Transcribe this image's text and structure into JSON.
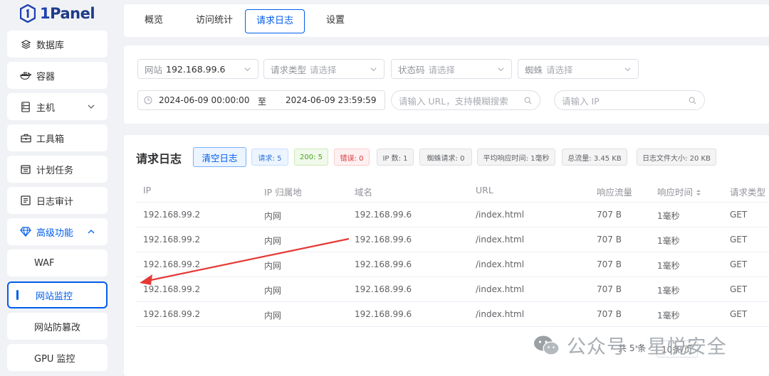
{
  "brand": {
    "logo_prefix": "1",
    "logo_name": "Panel"
  },
  "sidebar": {
    "items": [
      {
        "label": "数据库",
        "icon": "database-icon"
      },
      {
        "label": "容器",
        "icon": "docker-icon"
      },
      {
        "label": "主机",
        "icon": "host-icon"
      },
      {
        "label": "工具箱",
        "icon": "toolbox-icon"
      },
      {
        "label": "计划任务",
        "icon": "calendar-icon"
      },
      {
        "label": "日志审计",
        "icon": "log-audit-icon"
      },
      {
        "label": "高级功能",
        "icon": "diamond-icon"
      }
    ],
    "subitems": [
      {
        "label": "WAF"
      },
      {
        "label": "网站监控"
      },
      {
        "label": "网站防篡改"
      },
      {
        "label": "GPU 监控"
      }
    ]
  },
  "tabs": [
    {
      "label": "概览"
    },
    {
      "label": "访问统计"
    },
    {
      "label": "请求日志"
    },
    {
      "label": "设置"
    }
  ],
  "filters": {
    "site": {
      "label": "网站",
      "value": "192.168.99.6"
    },
    "request_type": {
      "label": "请求类型",
      "placeholder": "请选择"
    },
    "status_code": {
      "label": "状态码",
      "placeholder": "请选择"
    },
    "spider": {
      "label": "蜘蛛",
      "placeholder": "请选择"
    },
    "date_start": "2024-06-09 00:00:00",
    "date_sep": "至",
    "date_end": "2024-06-09 23:59:59",
    "url_placeholder": "请输入 URL，支持模糊搜索",
    "ip_placeholder": "请输入 IP"
  },
  "log": {
    "title": "请求日志",
    "clear_label": "清空日志",
    "stats": [
      "请求: 5",
      "200: 5",
      "错误: 0",
      "IP 数: 1",
      "蜘蛛请求: 0",
      "平均响应时间: 1毫秒",
      "总流量: 3.45 KB",
      "日志文件大小: 20 KB"
    ],
    "columns": [
      "IP",
      "IP 归属地",
      "域名",
      "URL",
      "响应流量",
      "响应时间",
      "请求类型"
    ],
    "rows": [
      [
        "192.168.99.2",
        "内网",
        "192.168.99.6",
        "/index.html",
        "707 B",
        "1毫秒",
        "GET"
      ],
      [
        "192.168.99.2",
        "内网",
        "192.168.99.6",
        "/index.html",
        "707 B",
        "1毫秒",
        "GET"
      ],
      [
        "192.168.99.2",
        "内网",
        "192.168.99.6",
        "/index.html",
        "707 B",
        "1毫秒",
        "GET"
      ],
      [
        "192.168.99.2",
        "内网",
        "192.168.99.6",
        "/index.html",
        "707 B",
        "1毫秒",
        "GET"
      ],
      [
        "192.168.99.2",
        "内网",
        "192.168.99.6",
        "/index.html",
        "707 B",
        "1毫秒",
        "GET"
      ]
    ],
    "total": "共 5 条",
    "page_size": "10条/页"
  },
  "watermark": {
    "text": "公众号 · 星悦安全"
  },
  "colors": {
    "primary": "#005eeb",
    "annotation": "#e53935"
  }
}
